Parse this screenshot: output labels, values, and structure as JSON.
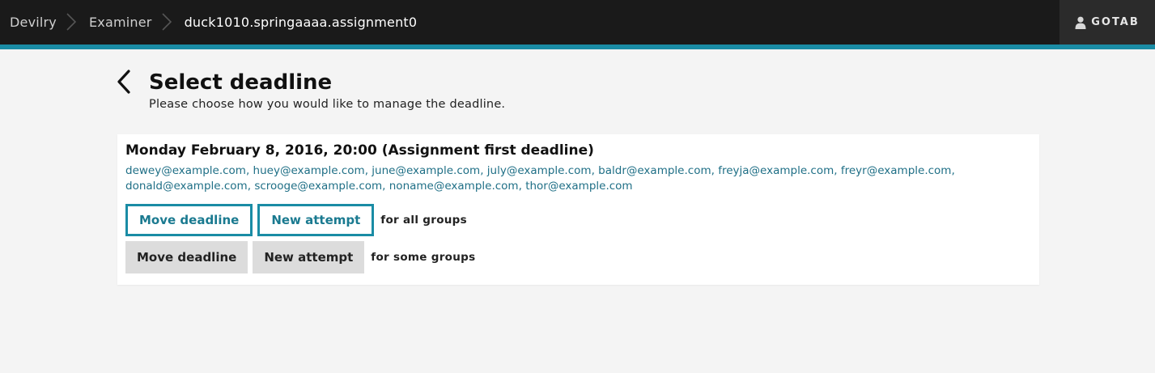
{
  "breadcrumb": {
    "items": [
      "Devilry",
      "Examiner",
      "duck1010.springaaaa.assignment0"
    ]
  },
  "user": {
    "name": "GOTAB",
    "icon": "user-icon"
  },
  "colors": {
    "accent": "#1a8ca5",
    "topbar": "#1a1a1a",
    "link": "#1f6f86"
  },
  "page": {
    "title": "Select deadline",
    "subtitle": "Please choose how you would like to manage the deadline."
  },
  "deadline": {
    "title": "Monday February 8, 2016, 20:00 (Assignment first deadline)",
    "emails": [
      "dewey@example.com",
      "huey@example.com",
      "june@example.com",
      "july@example.com",
      "baldr@example.com",
      "freyja@example.com",
      "freyr@example.com",
      "donald@example.com",
      "scrooge@example.com",
      "noname@example.com",
      "thor@example.com"
    ],
    "all_groups": {
      "move_label": "Move deadline",
      "attempt_label": "New attempt",
      "scope_label": "for all groups"
    },
    "some_groups": {
      "move_label": "Move deadline",
      "attempt_label": "New attempt",
      "scope_label": "for some groups"
    }
  }
}
